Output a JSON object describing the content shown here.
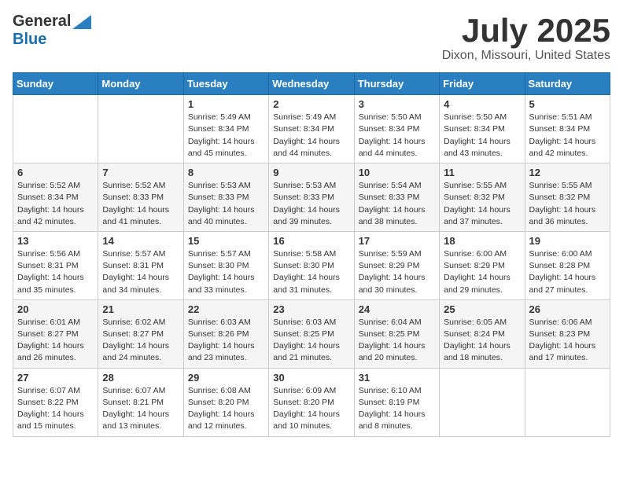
{
  "header": {
    "logo_general": "General",
    "logo_blue": "Blue",
    "title": "July 2025",
    "location": "Dixon, Missouri, United States"
  },
  "weekdays": [
    "Sunday",
    "Monday",
    "Tuesday",
    "Wednesday",
    "Thursday",
    "Friday",
    "Saturday"
  ],
  "weeks": [
    [
      {
        "day": "",
        "sunrise": "",
        "sunset": "",
        "daylight": ""
      },
      {
        "day": "",
        "sunrise": "",
        "sunset": "",
        "daylight": ""
      },
      {
        "day": "1",
        "sunrise": "Sunrise: 5:49 AM",
        "sunset": "Sunset: 8:34 PM",
        "daylight": "Daylight: 14 hours and 45 minutes."
      },
      {
        "day": "2",
        "sunrise": "Sunrise: 5:49 AM",
        "sunset": "Sunset: 8:34 PM",
        "daylight": "Daylight: 14 hours and 44 minutes."
      },
      {
        "day": "3",
        "sunrise": "Sunrise: 5:50 AM",
        "sunset": "Sunset: 8:34 PM",
        "daylight": "Daylight: 14 hours and 44 minutes."
      },
      {
        "day": "4",
        "sunrise": "Sunrise: 5:50 AM",
        "sunset": "Sunset: 8:34 PM",
        "daylight": "Daylight: 14 hours and 43 minutes."
      },
      {
        "day": "5",
        "sunrise": "Sunrise: 5:51 AM",
        "sunset": "Sunset: 8:34 PM",
        "daylight": "Daylight: 14 hours and 42 minutes."
      }
    ],
    [
      {
        "day": "6",
        "sunrise": "Sunrise: 5:52 AM",
        "sunset": "Sunset: 8:34 PM",
        "daylight": "Daylight: 14 hours and 42 minutes."
      },
      {
        "day": "7",
        "sunrise": "Sunrise: 5:52 AM",
        "sunset": "Sunset: 8:33 PM",
        "daylight": "Daylight: 14 hours and 41 minutes."
      },
      {
        "day": "8",
        "sunrise": "Sunrise: 5:53 AM",
        "sunset": "Sunset: 8:33 PM",
        "daylight": "Daylight: 14 hours and 40 minutes."
      },
      {
        "day": "9",
        "sunrise": "Sunrise: 5:53 AM",
        "sunset": "Sunset: 8:33 PM",
        "daylight": "Daylight: 14 hours and 39 minutes."
      },
      {
        "day": "10",
        "sunrise": "Sunrise: 5:54 AM",
        "sunset": "Sunset: 8:33 PM",
        "daylight": "Daylight: 14 hours and 38 minutes."
      },
      {
        "day": "11",
        "sunrise": "Sunrise: 5:55 AM",
        "sunset": "Sunset: 8:32 PM",
        "daylight": "Daylight: 14 hours and 37 minutes."
      },
      {
        "day": "12",
        "sunrise": "Sunrise: 5:55 AM",
        "sunset": "Sunset: 8:32 PM",
        "daylight": "Daylight: 14 hours and 36 minutes."
      }
    ],
    [
      {
        "day": "13",
        "sunrise": "Sunrise: 5:56 AM",
        "sunset": "Sunset: 8:31 PM",
        "daylight": "Daylight: 14 hours and 35 minutes."
      },
      {
        "day": "14",
        "sunrise": "Sunrise: 5:57 AM",
        "sunset": "Sunset: 8:31 PM",
        "daylight": "Daylight: 14 hours and 34 minutes."
      },
      {
        "day": "15",
        "sunrise": "Sunrise: 5:57 AM",
        "sunset": "Sunset: 8:30 PM",
        "daylight": "Daylight: 14 hours and 33 minutes."
      },
      {
        "day": "16",
        "sunrise": "Sunrise: 5:58 AM",
        "sunset": "Sunset: 8:30 PM",
        "daylight": "Daylight: 14 hours and 31 minutes."
      },
      {
        "day": "17",
        "sunrise": "Sunrise: 5:59 AM",
        "sunset": "Sunset: 8:29 PM",
        "daylight": "Daylight: 14 hours and 30 minutes."
      },
      {
        "day": "18",
        "sunrise": "Sunrise: 6:00 AM",
        "sunset": "Sunset: 8:29 PM",
        "daylight": "Daylight: 14 hours and 29 minutes."
      },
      {
        "day": "19",
        "sunrise": "Sunrise: 6:00 AM",
        "sunset": "Sunset: 8:28 PM",
        "daylight": "Daylight: 14 hours and 27 minutes."
      }
    ],
    [
      {
        "day": "20",
        "sunrise": "Sunrise: 6:01 AM",
        "sunset": "Sunset: 8:27 PM",
        "daylight": "Daylight: 14 hours and 26 minutes."
      },
      {
        "day": "21",
        "sunrise": "Sunrise: 6:02 AM",
        "sunset": "Sunset: 8:27 PM",
        "daylight": "Daylight: 14 hours and 24 minutes."
      },
      {
        "day": "22",
        "sunrise": "Sunrise: 6:03 AM",
        "sunset": "Sunset: 8:26 PM",
        "daylight": "Daylight: 14 hours and 23 minutes."
      },
      {
        "day": "23",
        "sunrise": "Sunrise: 6:03 AM",
        "sunset": "Sunset: 8:25 PM",
        "daylight": "Daylight: 14 hours and 21 minutes."
      },
      {
        "day": "24",
        "sunrise": "Sunrise: 6:04 AM",
        "sunset": "Sunset: 8:25 PM",
        "daylight": "Daylight: 14 hours and 20 minutes."
      },
      {
        "day": "25",
        "sunrise": "Sunrise: 6:05 AM",
        "sunset": "Sunset: 8:24 PM",
        "daylight": "Daylight: 14 hours and 18 minutes."
      },
      {
        "day": "26",
        "sunrise": "Sunrise: 6:06 AM",
        "sunset": "Sunset: 8:23 PM",
        "daylight": "Daylight: 14 hours and 17 minutes."
      }
    ],
    [
      {
        "day": "27",
        "sunrise": "Sunrise: 6:07 AM",
        "sunset": "Sunset: 8:22 PM",
        "daylight": "Daylight: 14 hours and 15 minutes."
      },
      {
        "day": "28",
        "sunrise": "Sunrise: 6:07 AM",
        "sunset": "Sunset: 8:21 PM",
        "daylight": "Daylight: 14 hours and 13 minutes."
      },
      {
        "day": "29",
        "sunrise": "Sunrise: 6:08 AM",
        "sunset": "Sunset: 8:20 PM",
        "daylight": "Daylight: 14 hours and 12 minutes."
      },
      {
        "day": "30",
        "sunrise": "Sunrise: 6:09 AM",
        "sunset": "Sunset: 8:20 PM",
        "daylight": "Daylight: 14 hours and 10 minutes."
      },
      {
        "day": "31",
        "sunrise": "Sunrise: 6:10 AM",
        "sunset": "Sunset: 8:19 PM",
        "daylight": "Daylight: 14 hours and 8 minutes."
      },
      {
        "day": "",
        "sunrise": "",
        "sunset": "",
        "daylight": ""
      },
      {
        "day": "",
        "sunrise": "",
        "sunset": "",
        "daylight": ""
      }
    ]
  ]
}
